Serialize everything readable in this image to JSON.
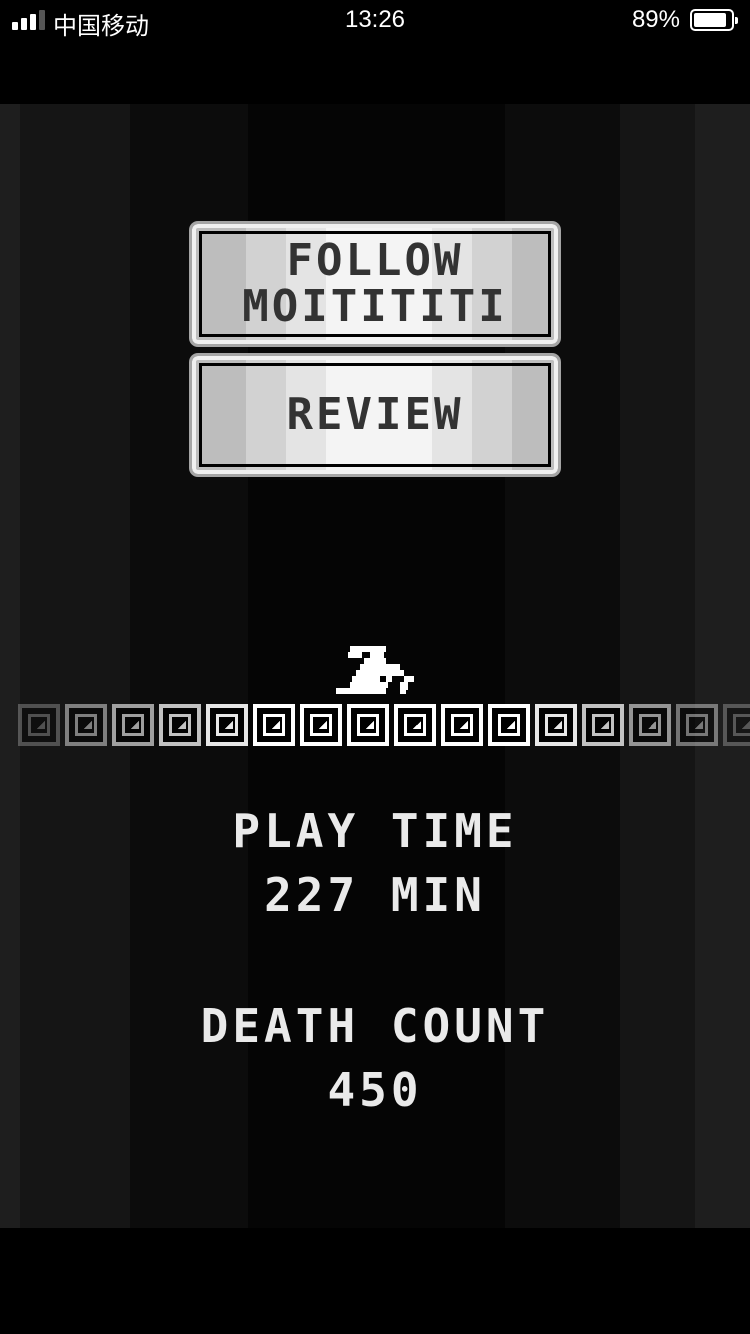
{
  "status_bar": {
    "carrier": "中国移动",
    "time": "13:26",
    "battery_percent": "89%",
    "battery_level": 0.89,
    "signal_bars_active": 3,
    "signal_bars_total": 4
  },
  "menu": {
    "follow_line1": "FOLLOW",
    "follow_line2": "MOITITITI",
    "review_label": "REVIEW"
  },
  "stats": {
    "play_time_label": "PLAY TIME",
    "play_time_value": "227 MIN",
    "death_count_label": "DEATH COUNT",
    "death_count_value": "450"
  },
  "floor": {
    "tile_count": 16,
    "tile_brightness": [
      0.25,
      0.45,
      0.6,
      0.75,
      0.9,
      1,
      1,
      1,
      1,
      1,
      1,
      0.9,
      0.75,
      0.55,
      0.4,
      0.25
    ]
  },
  "colors": {
    "text": "#eaeaea",
    "button_text": "#333333",
    "background": "#000000"
  }
}
